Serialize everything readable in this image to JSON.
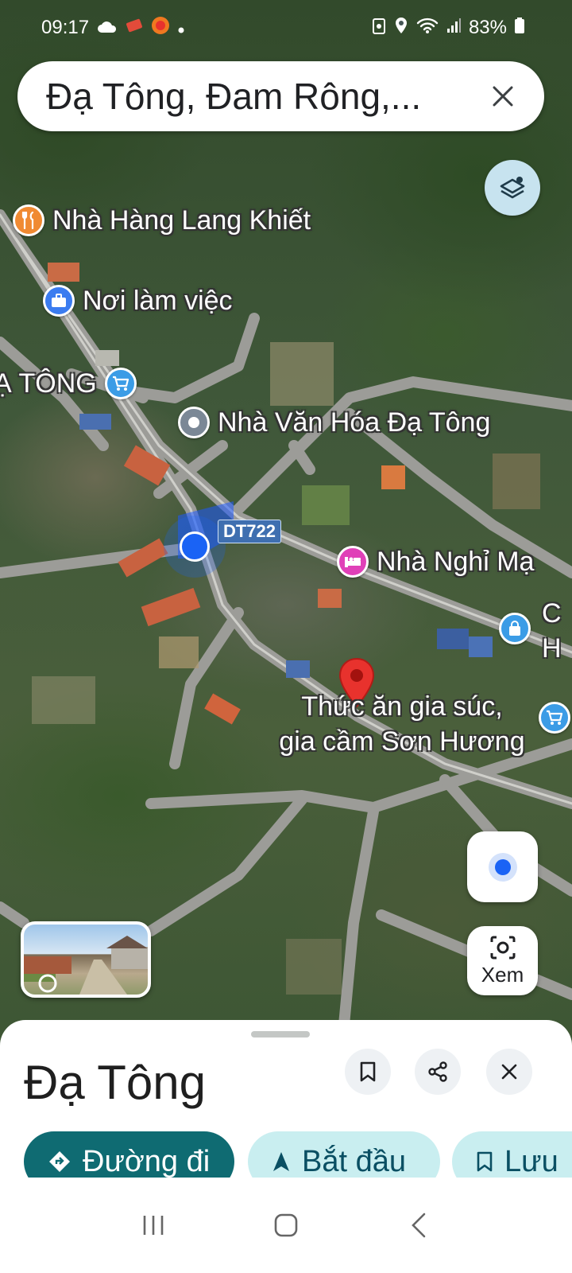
{
  "status_bar": {
    "time": "09:17",
    "battery": "83%",
    "left_icons": [
      "cloud-icon",
      "ticket-icon",
      "app-icon",
      "dot-icon"
    ],
    "right_icons": [
      "recycle-icon",
      "location-icon",
      "wifi-icon",
      "signal-icon",
      "battery-icon"
    ]
  },
  "search": {
    "query": "Đạ Tông, Đam Rông,..."
  },
  "map": {
    "pois": [
      {
        "name": "Nhà Hàng Lang Khiết",
        "type": "restaurant",
        "icon": "fork-knife-icon",
        "color": "#f08a32"
      },
      {
        "name": "Nơi làm việc",
        "type": "work",
        "icon": "briefcase-icon",
        "color": "#3b7cf0"
      },
      {
        "name": "Ạ TÔNG",
        "type": "shop",
        "icon": "shopping-cart-icon",
        "color": "#3b9ce6"
      },
      {
        "name": "Nhà Văn Hóa Đạ Tông",
        "type": "landmark",
        "icon": "landmark-icon",
        "color": "#7b8896"
      },
      {
        "name": "Nhà Nghỉ Mạ",
        "type": "hotel",
        "icon": "bed-icon",
        "color": "#e040b8"
      },
      {
        "name": "C",
        "type": "store",
        "icon": "bag-icon",
        "color": "#3b9ce6"
      },
      {
        "name": "H",
        "type": "store",
        "icon": "",
        "color": ""
      },
      {
        "name": "",
        "type": "shop",
        "icon": "shopping-cart-icon",
        "color": "#3b9ce6"
      }
    ],
    "road_label": "DT722",
    "selected_place_label_line1": "Thức ăn gia súc,",
    "selected_place_label_line2": "gia cầm Sơn Hương"
  },
  "controls": {
    "xem_label": "Xem"
  },
  "sheet": {
    "title": "Đạ Tông",
    "actions": {
      "directions": "Đường đi",
      "start": "Bắt đầu",
      "save": "Lưu"
    }
  },
  "colors": {
    "primary_chip": "#0f6b72",
    "secondary_chip": "#c9eef0",
    "pin_red": "#e8322d",
    "my_location": "#1a63f5"
  }
}
